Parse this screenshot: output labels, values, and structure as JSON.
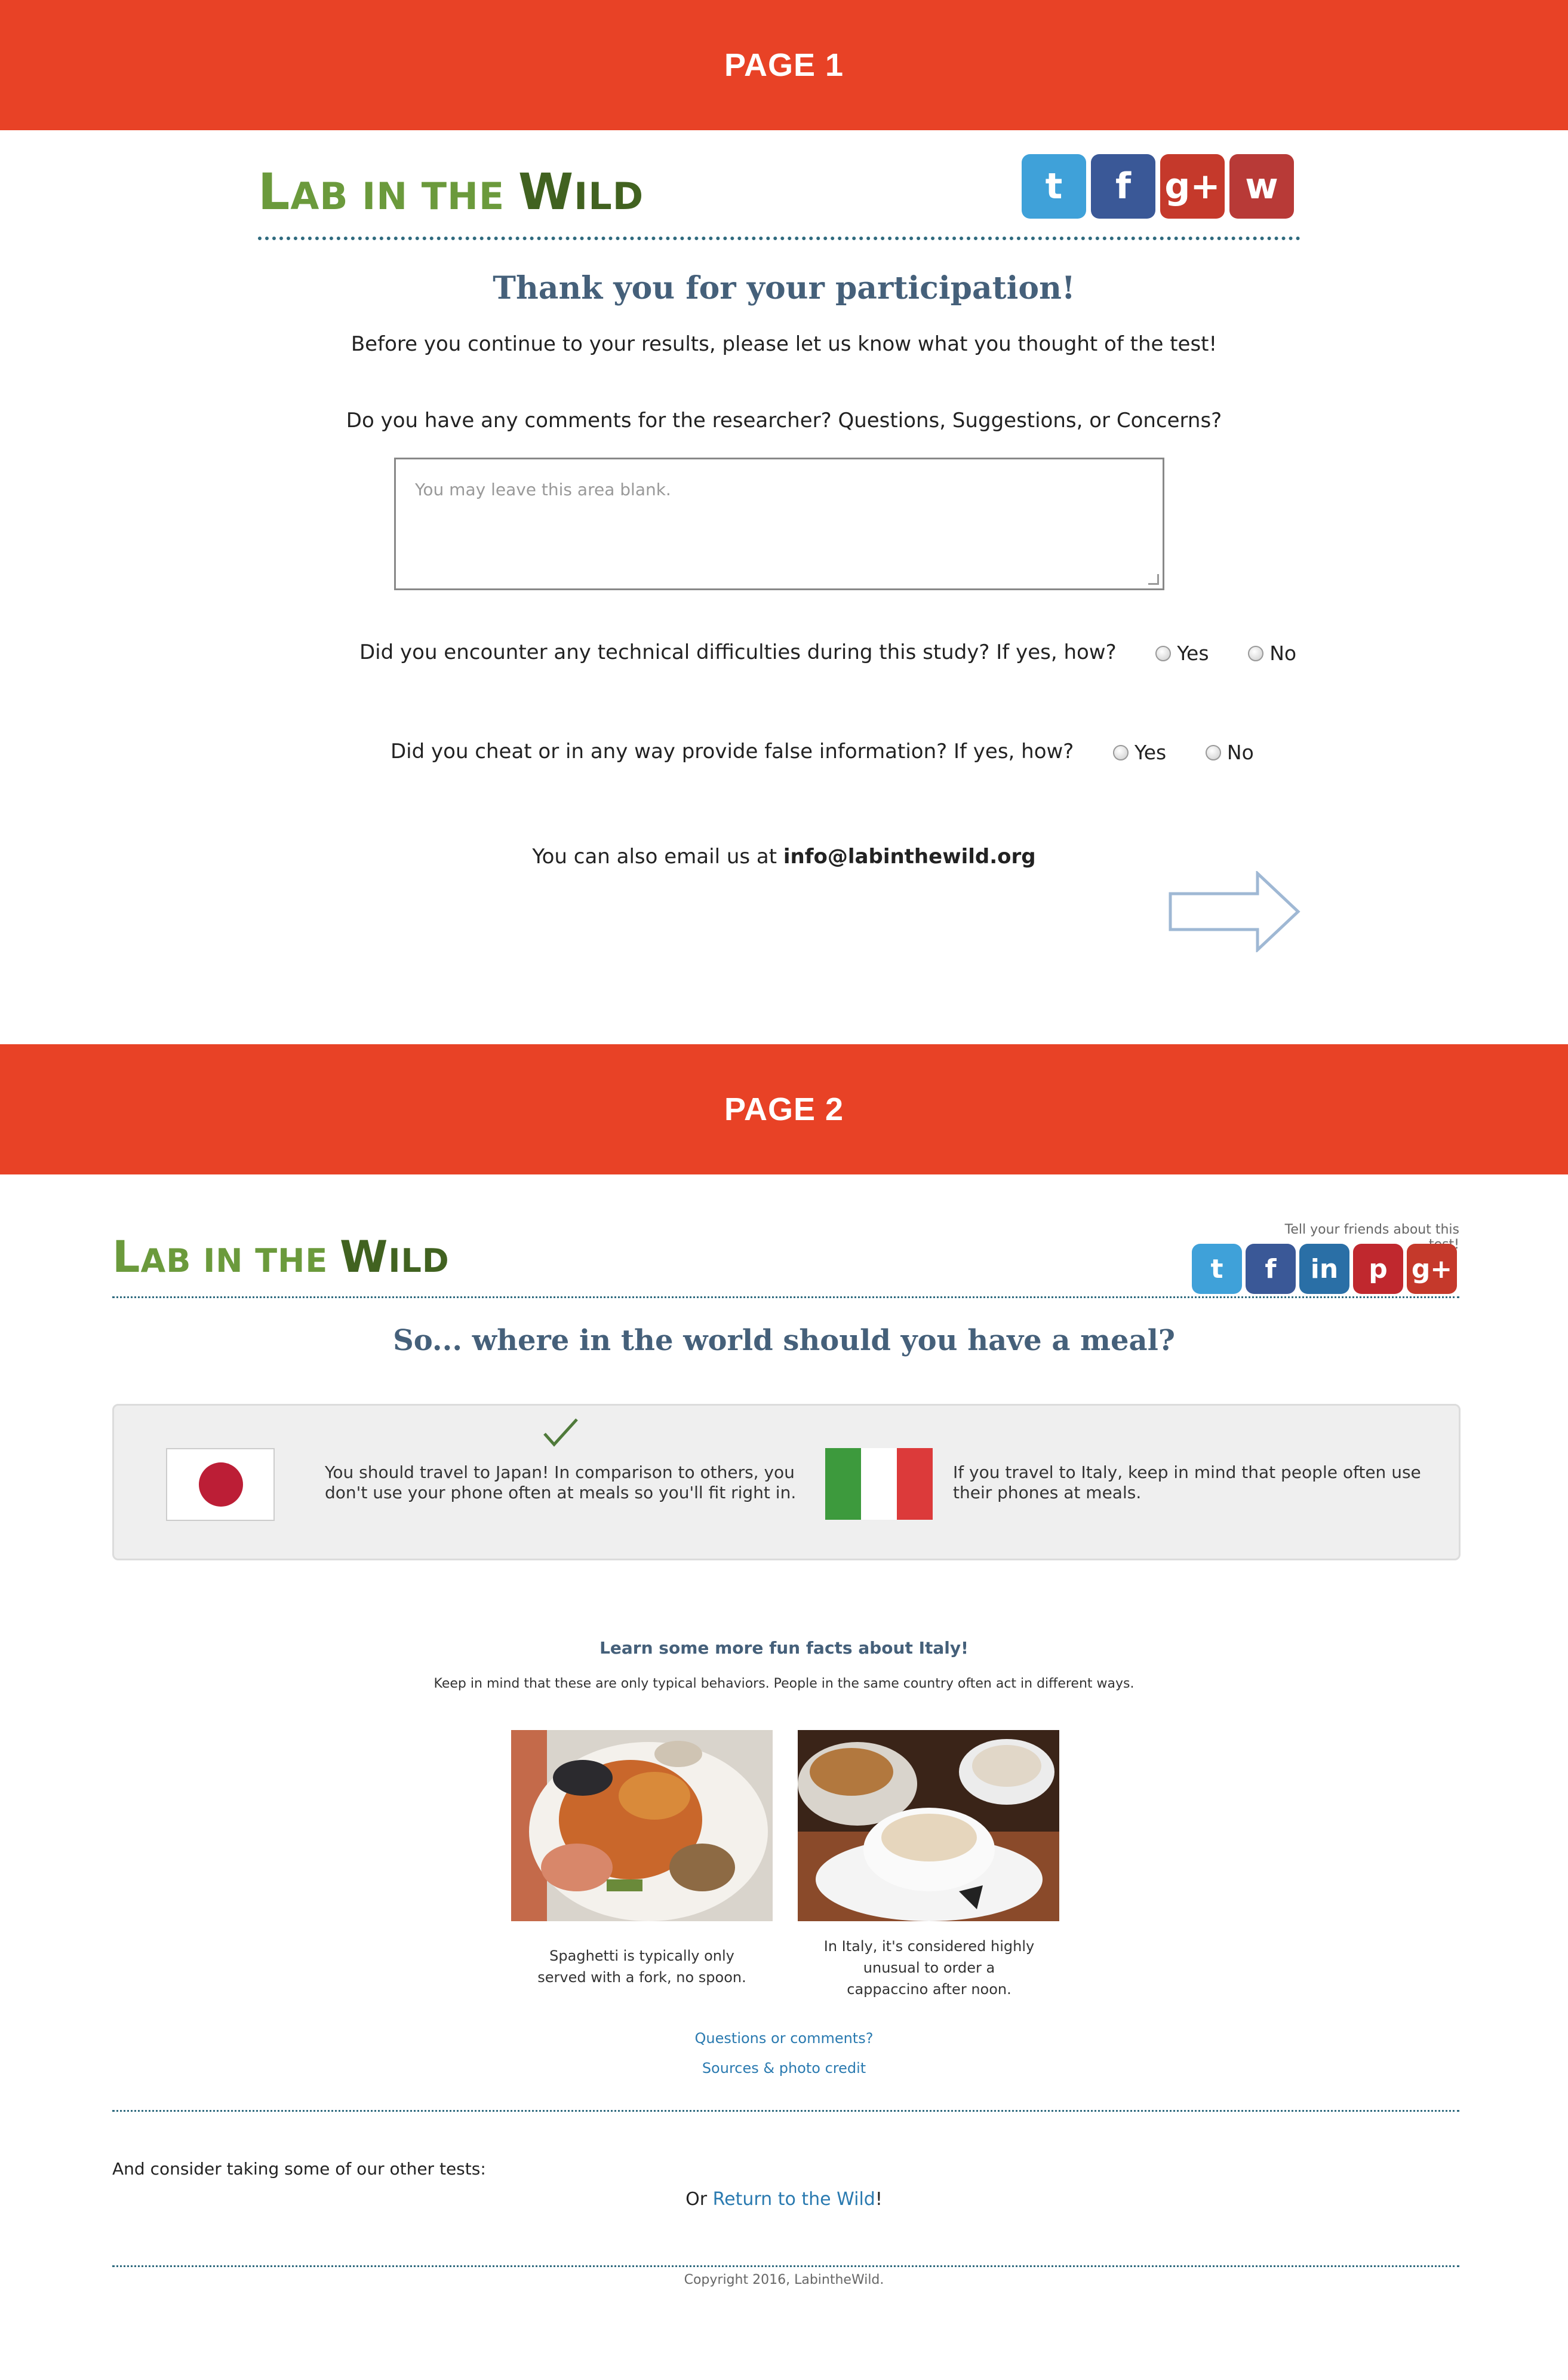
{
  "page1": {
    "banner": "PAGE 1",
    "logo": {
      "part1": "L",
      "part2": "AB IN THE ",
      "part3": "W",
      "part4": "ILD"
    },
    "social": [
      {
        "name": "twitter-icon",
        "glyph": "t",
        "color": "#3fa1d9"
      },
      {
        "name": "facebook-icon",
        "glyph": "f",
        "color": "#3a5897"
      },
      {
        "name": "google-plus-icon",
        "glyph": "g+",
        "color": "#c5392b"
      },
      {
        "name": "weibo-icon",
        "glyph": "w",
        "color": "#b83a37"
      }
    ],
    "title": "Thank you for your participation!",
    "intro": "Before you continue to your results, please let us know what you thought of the test!",
    "comments_question": "Do you have any comments for the researcher? Questions, Suggestions, or Concerns?",
    "comments_placeholder": "You may leave this area blank.",
    "q_technical": "Did you encounter any technical difficulties during this study? If yes, how?",
    "q_cheat": "Did you cheat or in any way provide false information? If yes, how?",
    "yes": "Yes",
    "no": "No",
    "email_prefix": "You can also email us at ",
    "email": "info@labinthewild.org"
  },
  "page2": {
    "banner": "PAGE 2",
    "tell_friends": "Tell your friends about this test!",
    "social": [
      {
        "name": "twitter-icon",
        "glyph": "t",
        "color": "#3fa1d9"
      },
      {
        "name": "facebook-icon",
        "glyph": "f",
        "color": "#3a5897"
      },
      {
        "name": "linkedin-icon",
        "glyph": "in",
        "color": "#2a6fa6"
      },
      {
        "name": "pinterest-icon",
        "glyph": "p",
        "color": "#c0282e"
      },
      {
        "name": "google-plus-icon",
        "glyph": "g+",
        "color": "#c5392b"
      }
    ],
    "title": "So... where in the world should you have a meal?",
    "japan_text": "You should travel to Japan! In comparison to others, you don't use your phone often at meals so you'll fit right in.",
    "italy_text": "If you travel to Italy, keep in mind that people often use their phones at meals.",
    "facts_title": "Learn some more fun facts about Italy!",
    "facts_subtitle": "Keep in mind that these are only typical behaviors. People in the same country often act in different ways.",
    "caption1": "Spaghetti is typically only served with a fork, no spoon.",
    "caption2": "In Italy, it's considered highly unusual to order a cappaccino after noon.",
    "link_questions": "Questions or comments?",
    "link_sources": "Sources & photo credit",
    "other_tests": "And consider taking some of our other tests:",
    "or": "Or ",
    "return_link": "Return to the Wild",
    "exclaim": "!",
    "copyright": "Copyright 2016, LabintheWild."
  }
}
